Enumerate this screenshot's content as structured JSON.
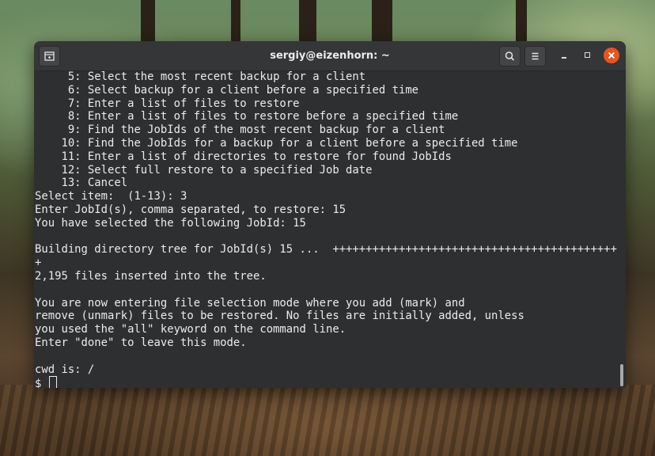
{
  "window": {
    "title": "sergiy@eizenhorn: ~"
  },
  "terminal": {
    "lines": [
      "     5: Select the most recent backup for a client",
      "     6: Select backup for a client before a specified time",
      "     7: Enter a list of files to restore",
      "     8: Enter a list of files to restore before a specified time",
      "     9: Find the JobIds of the most recent backup for a client",
      "    10: Find the JobIds for a backup for a client before a specified time",
      "    11: Enter a list of directories to restore for found JobIds",
      "    12: Select full restore to a specified Job date",
      "    13: Cancel",
      "Select item:  (1-13): 3",
      "Enter JobId(s), comma separated, to restore: 15",
      "You have selected the following JobId: 15",
      "",
      "Building directory tree for JobId(s) 15 ...  +++++++++++++++++++++++++++++++++++++++++++",
      "+",
      "2,195 files inserted into the tree.",
      "",
      "You are now entering file selection mode where you add (mark) and",
      "remove (unmark) files to be restored. No files are initially added, unless",
      "you used the \"all\" keyword on the command line.",
      "Enter \"done\" to leave this mode.",
      "",
      "cwd is: /"
    ],
    "prompt": "$ "
  },
  "icons": {
    "new_tab": "new-tab-icon",
    "search": "search-icon",
    "menu": "hamburger-menu-icon",
    "minimize": "minimize-icon",
    "maximize": "maximize-icon",
    "close": "close-icon"
  },
  "colors": {
    "terminal_bg": "#2e2f31",
    "text": "#ebebeb",
    "titlebar": "#353637",
    "close_button": "#e95420"
  }
}
